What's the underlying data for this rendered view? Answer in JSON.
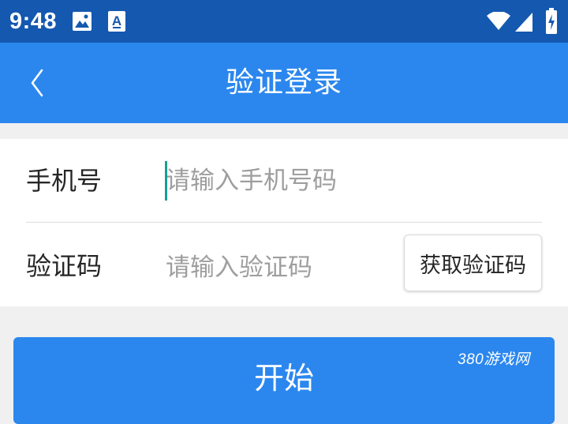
{
  "status_bar": {
    "time": "9:48",
    "icons": [
      "image-icon",
      "font-a-icon",
      "wifi-icon",
      "signal-icon",
      "battery-charging-icon"
    ]
  },
  "app_bar": {
    "title": "验证登录",
    "back_icon": "chevron-left-icon"
  },
  "form": {
    "phone": {
      "label": "手机号",
      "value": "",
      "placeholder": "请输入手机号码"
    },
    "code": {
      "label": "验证码",
      "value": "",
      "placeholder": "请输入验证码",
      "button_label": "获取验证码"
    }
  },
  "start_button": {
    "label": "开始"
  },
  "watermark": "380游戏网",
  "colors": {
    "status_bar": "#1458b0",
    "primary": "#2b87ee",
    "caret": "#16a08f",
    "background": "#f0f0f0",
    "placeholder": "#9e9e9e"
  }
}
